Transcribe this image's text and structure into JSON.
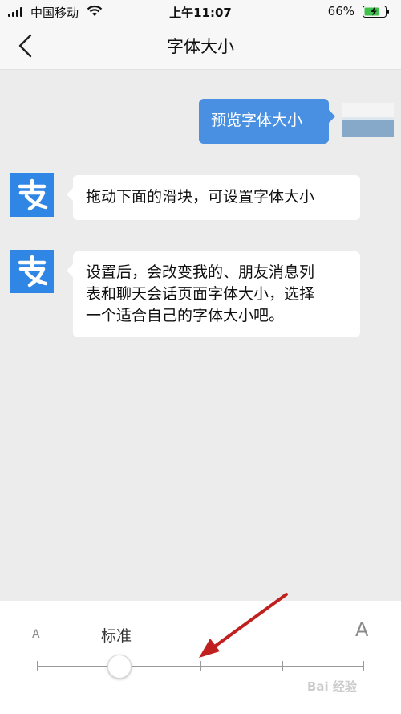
{
  "status": {
    "carrier": "中国移动",
    "time": "上午11:07",
    "battery": "66%"
  },
  "nav": {
    "title": "字体大小"
  },
  "messages": {
    "preview": "预览字体大小",
    "hint1": "拖动下面的滑块，可设置字体大小",
    "hint2_line1": "设置后，会改变我的、朋友消息列",
    "hint2_line2": "表和聊天会话页面字体大小，选择",
    "hint2_line3": "一个适合自己的字体大小吧。"
  },
  "avatar_glyph": "支",
  "font_slider": {
    "small_label": "A",
    "large_label": "A",
    "current_label": "标准",
    "stops": 5,
    "selected_index": 1
  },
  "watermark": "Bai 经验",
  "colors": {
    "bubble_blue": "#4a90e2",
    "alipay_blue": "#2f86e4",
    "chat_bg": "#ececec",
    "annotation_red": "#c0211e"
  },
  "icons": [
    "signal-icon",
    "wifi-icon",
    "battery-charging-icon",
    "back-arrow-icon",
    "alipay-avatar-icon"
  ]
}
